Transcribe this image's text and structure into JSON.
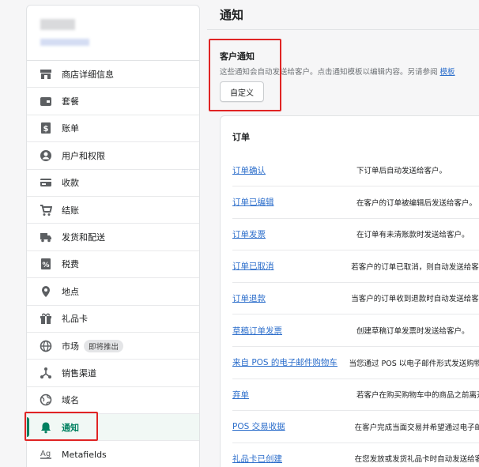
{
  "sidebar": {
    "items": [
      {
        "name": "sidebar-item-store-details",
        "icon": "store-icon",
        "label": "商店详细信息"
      },
      {
        "name": "sidebar-item-plan",
        "icon": "plan-icon",
        "label": "套餐"
      },
      {
        "name": "sidebar-item-billing",
        "icon": "dollar-icon",
        "label": "账单"
      },
      {
        "name": "sidebar-item-users",
        "icon": "user-icon",
        "label": "用户和权限"
      },
      {
        "name": "sidebar-item-payments",
        "icon": "card-icon",
        "label": "收款"
      },
      {
        "name": "sidebar-item-checkout",
        "icon": "cart-icon",
        "label": "结账"
      },
      {
        "name": "sidebar-item-shipping",
        "icon": "truck-icon",
        "label": "发货和配送"
      },
      {
        "name": "sidebar-item-taxes",
        "icon": "tax-icon",
        "label": "税费"
      },
      {
        "name": "sidebar-item-locations",
        "icon": "location-pin-icon",
        "label": "地点"
      },
      {
        "name": "sidebar-item-gift-cards",
        "icon": "gift-icon",
        "label": "礼品卡"
      },
      {
        "name": "sidebar-item-markets",
        "icon": "globe-icon",
        "label": "市场",
        "badge": "即将推出"
      },
      {
        "name": "sidebar-item-sales-channels",
        "icon": "channels-icon",
        "label": "销售渠道"
      },
      {
        "name": "sidebar-item-domains",
        "icon": "domain-globe-icon",
        "label": "域名"
      },
      {
        "name": "sidebar-item-notifications",
        "icon": "bell-icon",
        "label": "通知",
        "active": true
      },
      {
        "name": "sidebar-item-metafields",
        "icon": "metafields-icon",
        "label": "Metafields"
      }
    ]
  },
  "main": {
    "title": "通知",
    "customer": {
      "title": "客户通知",
      "description": "这些通知会自动发送给客户。点击通知模板以编辑内容。另请参阅 ",
      "link": "模板",
      "button": "自定义"
    },
    "orders": {
      "title": "订单",
      "rows": [
        {
          "name": "订单确认",
          "desc": "下订单后自动发送给客户。"
        },
        {
          "name": "订单已编辑",
          "desc": "在客户的订单被编辑后发送给客户。"
        },
        {
          "name": "订单发票",
          "desc": "在订单有未清账款时发送给客户。"
        },
        {
          "name": "订单已取消",
          "desc": "若客户的订单已取消，则自动发送给客户。"
        },
        {
          "name": "订单退款",
          "desc": "当客户的订单收到退款时自动发送给客户。"
        },
        {
          "name": "草稿订单发票",
          "desc": "创建草稿订单发票时发送给客户。"
        },
        {
          "name": "来自 POS 的电子邮件购物车",
          "desc": "当您通过 POS 以电子邮件形式发送购物车时"
        },
        {
          "name": "弃单",
          "desc": "若客户在购买购物车中的商品之前离开"
        },
        {
          "name": "POS 交易收据",
          "desc": "在客户完成当面交易并希望通过电子邮件"
        },
        {
          "name": "礼品卡已创建",
          "desc": "在您发放或发货礼品卡时自动发送给客户"
        }
      ]
    }
  },
  "colors": {
    "accent": "#008060",
    "link": "#2c6ecb",
    "highlight": "#e02424"
  }
}
